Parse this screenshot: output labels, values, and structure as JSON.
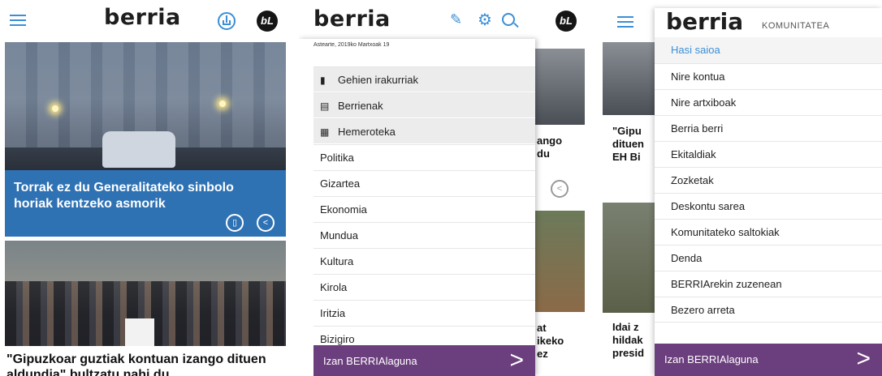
{
  "screen1": {
    "logo": "berria",
    "bl_badge": "bL",
    "top_story_title": "Torrak ez du Generalitateko sinbolo horiak kentzeko asmorik",
    "second_story_title": "\"Gipuzkoar guztiak kontuan izango dituen aldundia\" bultzatu nahi du"
  },
  "screen2": {
    "logo": "berria",
    "bl_badge": "bL",
    "date": "Astearte, 2019ko Martxoak 19",
    "menu_icon_items": [
      {
        "icon": "chart-icon",
        "glyph": "▮",
        "label": "Gehien irakurriak"
      },
      {
        "icon": "newspaper-icon",
        "glyph": "▤",
        "label": "Berrienak"
      },
      {
        "icon": "archive-icon",
        "glyph": "▦",
        "label": "Hemeroteka"
      }
    ],
    "sections": [
      "Politika",
      "Gizartea",
      "Ekonomia",
      "Mundua",
      "Kultura",
      "Kirola",
      "Iritzia",
      "Bizigiro"
    ],
    "footer_label": "Izan BERRIAlaguna",
    "footer_arrow": ">",
    "behind_text_1": "ango\ndu",
    "behind_text_2": "at\nikeko\nez"
  },
  "screen3": {
    "logo": "berria",
    "community_label": "KOMUNITATEA",
    "items": [
      "Hasi saioa",
      "Nire kontua",
      "Nire artxiboak",
      "Berria berri",
      "Ekitaldiak",
      "Zozketak",
      "Deskontu sarea",
      "Komunitateko saltokiak",
      "Denda",
      "BERRIArekin zuzenean",
      "Bezero arreta"
    ],
    "footer_label": "Izan BERRIAlaguna",
    "footer_arrow": ">",
    "behind_text_1": "\"Gipu\ndituen\nEH Bi",
    "behind_text_2": "Idai z\nhildak\npresid"
  }
}
